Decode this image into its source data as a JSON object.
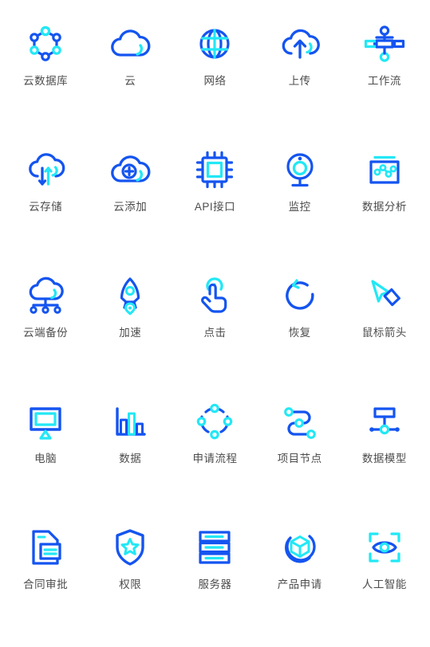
{
  "page": {
    "title": "图标集合",
    "background_color": "#ffffff",
    "label_color": "#4d4d4d",
    "columns": 5,
    "rows": 5
  },
  "palette": {
    "blue": "#1454f0",
    "cyan": "#22e8f5",
    "deep_blue": "#1340e0",
    "label_gray": "#4d4d4d"
  },
  "icons": [
    {
      "id": "cloud-database",
      "label": "云数据库",
      "icon_name": "cloud-database-icon",
      "row": 1,
      "col": 1
    },
    {
      "id": "cloud",
      "label": "云",
      "icon_name": "cloud-icon",
      "row": 1,
      "col": 2
    },
    {
      "id": "network",
      "label": "网络",
      "icon_name": "globe-network-icon",
      "row": 1,
      "col": 3
    },
    {
      "id": "upload",
      "label": "上传",
      "icon_name": "cloud-upload-icon",
      "row": 1,
      "col": 4
    },
    {
      "id": "workflow",
      "label": "工作流",
      "icon_name": "workflow-icon",
      "row": 1,
      "col": 5
    },
    {
      "id": "cloud-storage",
      "label": "云存储",
      "icon_name": "cloud-storage-icon",
      "row": 2,
      "col": 1
    },
    {
      "id": "cloud-add",
      "label": "云添加",
      "icon_name": "cloud-add-icon",
      "row": 2,
      "col": 2
    },
    {
      "id": "api",
      "label": "API接口",
      "icon_name": "chip-api-icon",
      "row": 2,
      "col": 3
    },
    {
      "id": "monitoring",
      "label": "监控",
      "icon_name": "camera-monitor-icon",
      "row": 2,
      "col": 4
    },
    {
      "id": "data-analysis",
      "label": "数据分析",
      "icon_name": "data-analysis-icon",
      "row": 2,
      "col": 5
    },
    {
      "id": "cloud-backup",
      "label": "云端备份",
      "icon_name": "cloud-backup-icon",
      "row": 3,
      "col": 1
    },
    {
      "id": "accelerate",
      "label": "加速",
      "icon_name": "rocket-icon",
      "row": 3,
      "col": 2
    },
    {
      "id": "click",
      "label": "点击",
      "icon_name": "click-hand-icon",
      "row": 3,
      "col": 3
    },
    {
      "id": "restore",
      "label": "恢复",
      "icon_name": "undo-restore-icon",
      "row": 3,
      "col": 4
    },
    {
      "id": "cursor",
      "label": "鼠标箭头",
      "icon_name": "mouse-cursor-icon",
      "row": 3,
      "col": 5
    },
    {
      "id": "computer",
      "label": "电脑",
      "icon_name": "monitor-icon",
      "row": 4,
      "col": 1
    },
    {
      "id": "data",
      "label": "数据",
      "icon_name": "bar-chart-icon",
      "row": 4,
      "col": 2
    },
    {
      "id": "apply-process",
      "label": "申请流程",
      "icon_name": "circular-flow-icon",
      "row": 4,
      "col": 3
    },
    {
      "id": "project-node",
      "label": "项目节点",
      "icon_name": "project-node-icon",
      "row": 4,
      "col": 4
    },
    {
      "id": "data-model",
      "label": "数据模型",
      "icon_name": "data-model-icon",
      "row": 4,
      "col": 5
    },
    {
      "id": "contract-approval",
      "label": "合同审批",
      "icon_name": "contract-approval-icon",
      "row": 5,
      "col": 1
    },
    {
      "id": "permission",
      "label": "权限",
      "icon_name": "shield-star-icon",
      "row": 5,
      "col": 2
    },
    {
      "id": "server",
      "label": "服务器",
      "icon_name": "server-rack-icon",
      "row": 5,
      "col": 3
    },
    {
      "id": "product-apply",
      "label": "产品申请",
      "icon_name": "cube-product-icon",
      "row": 5,
      "col": 4
    },
    {
      "id": "ai",
      "label": "人工智能",
      "icon_name": "ai-eye-scan-icon",
      "row": 5,
      "col": 5
    }
  ]
}
